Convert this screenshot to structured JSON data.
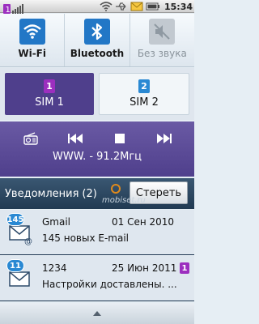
{
  "status_bar": {
    "sim_indicator": "1",
    "time": "15:34",
    "icons": [
      "signal-icon",
      "wifi-icon",
      "usb-icon",
      "message-icon",
      "battery-icon"
    ]
  },
  "toggles": [
    {
      "label": "Wi-Fi",
      "icon": "wifi-icon",
      "state": "on"
    },
    {
      "label": "Bluetooth",
      "icon": "bluetooth-icon",
      "state": "on"
    },
    {
      "label": "Без звука",
      "icon": "mute-icon",
      "state": "off"
    }
  ],
  "sims": [
    {
      "label": "SIM 1",
      "badge": "1",
      "active": true
    },
    {
      "label": "SIM 2",
      "badge": "2",
      "active": false
    }
  ],
  "radio": {
    "frequency": "WWW.    - 91.2Мгц",
    "controls": [
      "radio-icon",
      "previous-icon",
      "stop-icon",
      "next-icon"
    ]
  },
  "notifications": {
    "title": "Уведомления",
    "count": "(2)",
    "clear_label": "Стереть",
    "watermark": "mobiset.ru",
    "items": [
      {
        "badge": "145",
        "sender": "Gmail",
        "date": "01 Сен 2010",
        "text": "145 новых E-mail",
        "icon": "email-icon"
      },
      {
        "badge": "11",
        "sender": "1234",
        "date": "25 Июн 2011",
        "text": "Настройки доставлены. ...",
        "sim": "1",
        "icon": "message-icon"
      }
    ]
  },
  "colors": {
    "accent": "#4f3f8c",
    "blue": "#2277c6",
    "header": "#213a52"
  }
}
